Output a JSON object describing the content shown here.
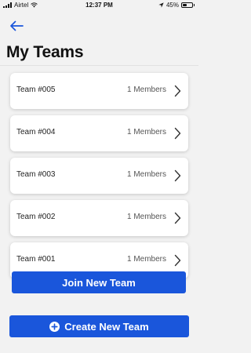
{
  "status_bar": {
    "carrier": "Airtel",
    "time": "12:37 PM",
    "battery": "45%",
    "battery_level": 0.45
  },
  "header": {
    "title": "My Teams"
  },
  "teams": [
    {
      "name": "Team #005",
      "members": "1 Members"
    },
    {
      "name": "Team #004",
      "members": "1 Members"
    },
    {
      "name": "Team #003",
      "members": "1 Members"
    },
    {
      "name": "Team #002",
      "members": "1 Members"
    },
    {
      "name": "Team #001",
      "members": "1 Members"
    }
  ],
  "actions": {
    "join_label": "Join New Team",
    "create_label": "Create New Team"
  },
  "colors": {
    "accent": "#1a56db",
    "background": "#f2f2f2",
    "card": "#ffffff"
  }
}
